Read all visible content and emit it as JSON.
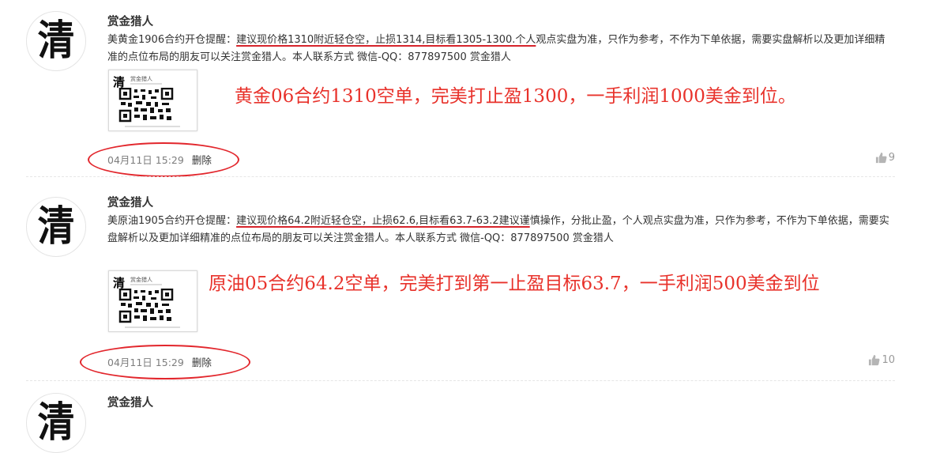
{
  "posts": [
    {
      "author": "赏金猎人",
      "text_prefix": "美黄金1906合约开仓提醒：",
      "text_underlined": "建议现价格1310附近轻仓空，止损1314,目标看1305-1300.个人",
      "text_suffix": "观点实盘为准，只作为参考，不作为下单依据，需要实盘解析以及更加详细精准的点位布局的朋友可以关注赏金猎人。本人联系方式 微信-QQ：877897500 赏金猎人",
      "overlay": "黄金06合约1310空单，完美打止盈1300，一手利润1000美金到位。",
      "time": "04月11日 15:29",
      "delete_label": "删除",
      "likes": "9"
    },
    {
      "author": "赏金猎人",
      "text_prefix": "美原油1905合约开仓提醒：",
      "text_underlined": "建议现价格64.2附近轻仓空，止损62.6,目标看63.7-63.2建议谨",
      "text_suffix": "慎操作，分批止盈，个人观点实盘为准，只作为参考，不作为下单依据，需要实盘解析以及更加详细精准的点位布局的朋友可以关注赏金猎人。本人联系方式 微信-QQ：877897500 赏金猎人",
      "overlay": "原油05合约64.2空单，完美打到第一止盈目标63.7，一手利润500美金到位",
      "time": "04月11日 15:29",
      "delete_label": "删除",
      "likes": "10"
    },
    {
      "author": "赏金猎人"
    }
  ],
  "avatar_char": "清",
  "thumb_name": "赏金猎人",
  "colors": {
    "accent_red": "#e2262c",
    "overlay_red": "#e8322b",
    "meta_gray": "#7d7d7d"
  },
  "icons": {
    "like": "thumbs-up-icon",
    "qr": "qr-code-icon"
  }
}
